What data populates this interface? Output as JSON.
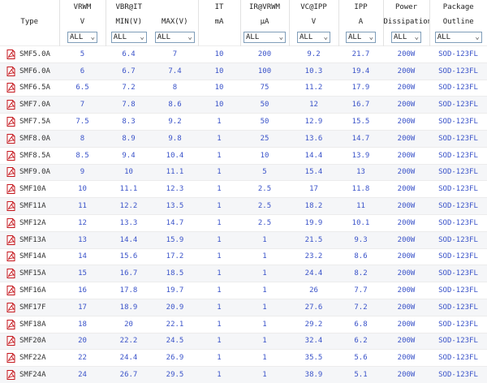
{
  "header": {
    "row1": [
      "",
      "VRWM",
      "VBR@IT",
      "",
      "IT",
      "IR@VRWM",
      "VC@IPP",
      "IPP",
      "Power",
      "Package"
    ],
    "row2": [
      "Type",
      "V",
      "MIN(V)",
      "MAX(V)",
      "mA",
      "μA",
      "V",
      "A",
      "Dissipation",
      "Outline"
    ],
    "filters": [
      "ALL",
      "ALL",
      "ALL",
      "ALL",
      "ALL",
      "ALL",
      "ALL",
      "ALL",
      "ALL"
    ]
  },
  "icons": {
    "pdf": "pdf-document-icon",
    "chevron": "chevron-down-icon",
    "pdf_color": "#c4161c"
  },
  "rows": [
    {
      "type": "SMF5.0A",
      "vrwm": "5",
      "vbr_min": "6.4",
      "vbr_max": "7",
      "it": "10",
      "ir": "200",
      "vc": "9.2",
      "ipp": "21.7",
      "power": "200W",
      "pkg": "SOD-123FL"
    },
    {
      "type": "SMF6.0A",
      "vrwm": "6",
      "vbr_min": "6.7",
      "vbr_max": "7.4",
      "it": "10",
      "ir": "100",
      "vc": "10.3",
      "ipp": "19.4",
      "power": "200W",
      "pkg": "SOD-123FL"
    },
    {
      "type": "SMF6.5A",
      "vrwm": "6.5",
      "vbr_min": "7.2",
      "vbr_max": "8",
      "it": "10",
      "ir": "75",
      "vc": "11.2",
      "ipp": "17.9",
      "power": "200W",
      "pkg": "SOD-123FL"
    },
    {
      "type": "SMF7.0A",
      "vrwm": "7",
      "vbr_min": "7.8",
      "vbr_max": "8.6",
      "it": "10",
      "ir": "50",
      "vc": "12",
      "ipp": "16.7",
      "power": "200W",
      "pkg": "SOD-123FL"
    },
    {
      "type": "SMF7.5A",
      "vrwm": "7.5",
      "vbr_min": "8.3",
      "vbr_max": "9.2",
      "it": "1",
      "ir": "50",
      "vc": "12.9",
      "ipp": "15.5",
      "power": "200W",
      "pkg": "SOD-123FL"
    },
    {
      "type": "SMF8.0A",
      "vrwm": "8",
      "vbr_min": "8.9",
      "vbr_max": "9.8",
      "it": "1",
      "ir": "25",
      "vc": "13.6",
      "ipp": "14.7",
      "power": "200W",
      "pkg": "SOD-123FL"
    },
    {
      "type": "SMF8.5A",
      "vrwm": "8.5",
      "vbr_min": "9.4",
      "vbr_max": "10.4",
      "it": "1",
      "ir": "10",
      "vc": "14.4",
      "ipp": "13.9",
      "power": "200W",
      "pkg": "SOD-123FL"
    },
    {
      "type": "SMF9.0A",
      "vrwm": "9",
      "vbr_min": "10",
      "vbr_max": "11.1",
      "it": "1",
      "ir": "5",
      "vc": "15.4",
      "ipp": "13",
      "power": "200W",
      "pkg": "SOD-123FL"
    },
    {
      "type": "SMF10A",
      "vrwm": "10",
      "vbr_min": "11.1",
      "vbr_max": "12.3",
      "it": "1",
      "ir": "2.5",
      "vc": "17",
      "ipp": "11.8",
      "power": "200W",
      "pkg": "SOD-123FL"
    },
    {
      "type": "SMF11A",
      "vrwm": "11",
      "vbr_min": "12.2",
      "vbr_max": "13.5",
      "it": "1",
      "ir": "2.5",
      "vc": "18.2",
      "ipp": "11",
      "power": "200W",
      "pkg": "SOD-123FL"
    },
    {
      "type": "SMF12A",
      "vrwm": "12",
      "vbr_min": "13.3",
      "vbr_max": "14.7",
      "it": "1",
      "ir": "2.5",
      "vc": "19.9",
      "ipp": "10.1",
      "power": "200W",
      "pkg": "SOD-123FL"
    },
    {
      "type": "SMF13A",
      "vrwm": "13",
      "vbr_min": "14.4",
      "vbr_max": "15.9",
      "it": "1",
      "ir": "1",
      "vc": "21.5",
      "ipp": "9.3",
      "power": "200W",
      "pkg": "SOD-123FL"
    },
    {
      "type": "SMF14A",
      "vrwm": "14",
      "vbr_min": "15.6",
      "vbr_max": "17.2",
      "it": "1",
      "ir": "1",
      "vc": "23.2",
      "ipp": "8.6",
      "power": "200W",
      "pkg": "SOD-123FL"
    },
    {
      "type": "SMF15A",
      "vrwm": "15",
      "vbr_min": "16.7",
      "vbr_max": "18.5",
      "it": "1",
      "ir": "1",
      "vc": "24.4",
      "ipp": "8.2",
      "power": "200W",
      "pkg": "SOD-123FL"
    },
    {
      "type": "SMF16A",
      "vrwm": "16",
      "vbr_min": "17.8",
      "vbr_max": "19.7",
      "it": "1",
      "ir": "1",
      "vc": "26",
      "ipp": "7.7",
      "power": "200W",
      "pkg": "SOD-123FL"
    },
    {
      "type": "SMF17F",
      "vrwm": "17",
      "vbr_min": "18.9",
      "vbr_max": "20.9",
      "it": "1",
      "ir": "1",
      "vc": "27.6",
      "ipp": "7.2",
      "power": "200W",
      "pkg": "SOD-123FL"
    },
    {
      "type": "SMF18A",
      "vrwm": "18",
      "vbr_min": "20",
      "vbr_max": "22.1",
      "it": "1",
      "ir": "1",
      "vc": "29.2",
      "ipp": "6.8",
      "power": "200W",
      "pkg": "SOD-123FL"
    },
    {
      "type": "SMF20A",
      "vrwm": "20",
      "vbr_min": "22.2",
      "vbr_max": "24.5",
      "it": "1",
      "ir": "1",
      "vc": "32.4",
      "ipp": "6.2",
      "power": "200W",
      "pkg": "SOD-123FL"
    },
    {
      "type": "SMF22A",
      "vrwm": "22",
      "vbr_min": "24.4",
      "vbr_max": "26.9",
      "it": "1",
      "ir": "1",
      "vc": "35.5",
      "ipp": "5.6",
      "power": "200W",
      "pkg": "SOD-123FL"
    },
    {
      "type": "SMF24A",
      "vrwm": "24",
      "vbr_min": "26.7",
      "vbr_max": "29.5",
      "it": "1",
      "ir": "1",
      "vc": "38.9",
      "ipp": "5.1",
      "power": "200W",
      "pkg": "SOD-123FL"
    }
  ]
}
